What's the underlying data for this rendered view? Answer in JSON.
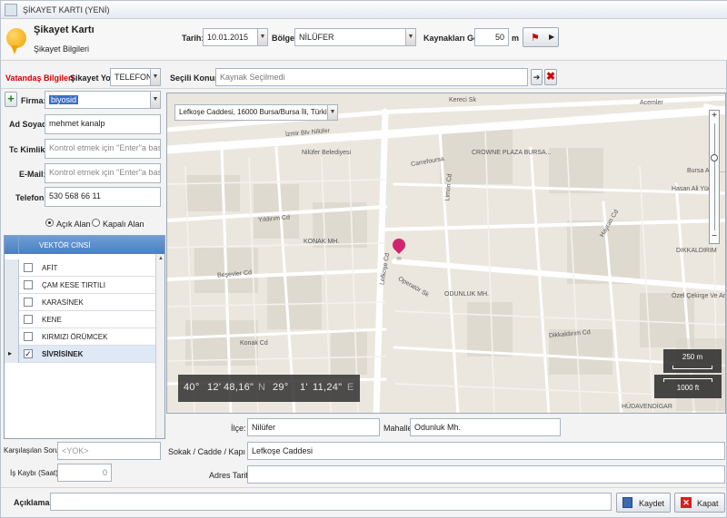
{
  "window": {
    "title": "ŞİKAYET KARTI (YENİ)"
  },
  "header": {
    "title": "Şikayet Kartı",
    "subtitle": "Şikayet Bilgileri",
    "date_label": "Tarih:",
    "date_value": "10.01.2015",
    "region_label": "Bölge:",
    "region_value": "NİLÜFER",
    "sources_label": "Kaynakları Getir:",
    "sources_value": "50",
    "sources_unit": "m"
  },
  "citizen": {
    "section_label": "Vatandaş Bilgileri",
    "complaint_channel_label": "Şikayet Yolu:",
    "complaint_channel_value": "TELEFON",
    "firm_label": "Firma:",
    "firm_value": "biyosid",
    "name_label": "Ad Soyad:",
    "name_value": "mehmet kanalp",
    "tc_label": "Tc Kimlik:",
    "tc_placeholder": "Kontrol etmek için \"Enter\"a basınız.",
    "email_label": "E-Mail:",
    "email_placeholder": "Kontrol etmek için \"Enter\"a basınız.",
    "phone_label": "Telefon:",
    "phone_value": "530 568 66 11",
    "open_area_label": "Açık Alan",
    "closed_area_label": "Kapalı Alan"
  },
  "vectors": {
    "header": "VEKTÖR CİNSİ",
    "rows": [
      {
        "name": "AFİT",
        "checked": false
      },
      {
        "name": "ÇAM KESE TIRTILI",
        "checked": false
      },
      {
        "name": "KARASİNEK",
        "checked": false
      },
      {
        "name": "KENE",
        "checked": false
      },
      {
        "name": "KIRMIZI ÖRÜMCEK",
        "checked": false
      },
      {
        "name": "SİVRİSİNEK",
        "checked": true
      }
    ]
  },
  "location": {
    "label": "Seçili Konum:",
    "value": "Kaynak Seçilmedi",
    "map_address": "Lefkoşe Caddesi, 16000 Bursa/Bursa İli, Türkiye"
  },
  "map": {
    "coords": {
      "lat_deg": "40°",
      "lat_min": "12'",
      "lat_sec": "48,16\"",
      "lat_dir": "N",
      "lon_deg": "29°",
      "lon_min": "1'",
      "lon_sec": "11,24\"",
      "lon_dir": "E"
    },
    "scale_m": "250 m",
    "scale_ft": "1000 ft",
    "labels": [
      {
        "text": "Kereci Sk"
      },
      {
        "text": "İzmir Blv Nilüfer"
      },
      {
        "text": "Nilüfer Belediyesi"
      },
      {
        "text": "CROWNE PLAZA BURSA..."
      },
      {
        "text": "Acemler"
      },
      {
        "text": "Bursa Anad..."
      },
      {
        "text": "Hasan Ali Yücel"
      },
      {
        "text": "DIKKALDIRIM"
      },
      {
        "text": "KONAK MH."
      },
      {
        "text": "Lefkoşe Cd"
      },
      {
        "text": "ODUNLUK MH."
      },
      {
        "text": "Operatör Sk"
      },
      {
        "text": "Yıldırım Cd"
      },
      {
        "text": "Beşevler Cd"
      },
      {
        "text": "Konak Cd"
      },
      {
        "text": "Dikkaldırım Cd"
      },
      {
        "text": "HÜDAVENDİGAR"
      },
      {
        "text": "Özel Çekirge Ve Antmi Hastanesi"
      },
      {
        "text": "Hayran Cd"
      },
      {
        "text": "Limon Cd"
      },
      {
        "text": "Carrefoursa"
      }
    ]
  },
  "address": {
    "district_label": "İlçe:",
    "district_value": "Nilüfer",
    "neighborhood_label": "Mahalle:",
    "neighborhood_value": "Odunluk Mh.",
    "street_label": "Sokak / Cadde / Kapı No:",
    "street_value": "Lefkoşe Caddesi",
    "directions_label": "Adres Tarifi:",
    "directions_value": ""
  },
  "extra": {
    "problem_label": "Karşılaşılan Sorun:",
    "problem_placeholder": "<YOK>",
    "work_loss_label": "İş Kaybı (Saat):",
    "work_loss_value": "0",
    "description_label": "Açıklama:"
  },
  "actions": {
    "save_label": "Kaydet",
    "close_label": "Kapat"
  }
}
